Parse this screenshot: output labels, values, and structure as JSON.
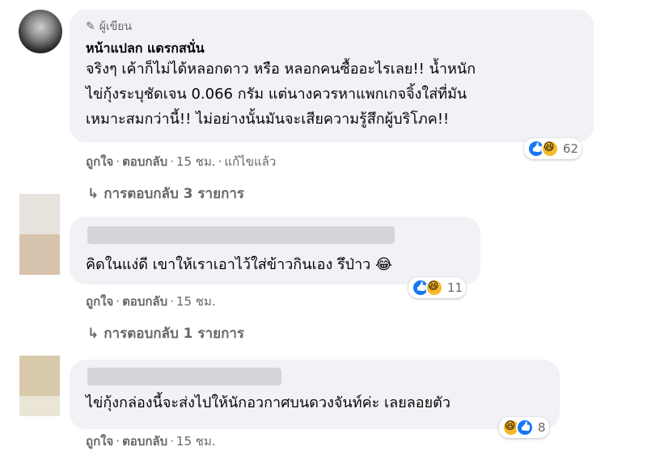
{
  "comments": [
    {
      "badge": "ผู้เขียน",
      "name": "หน้าแปลก แดรกสนั่น",
      "lines": [
        "จริงๆ เค้าก็ไม่ได้หลอกดาว หรือ หลอกคนซื้ออะไรเลย!! น้ำหนัก",
        "ไข่กุ้งระบุชัดเจน 0.066 กรัม แต่นางควรหาแพกเกจจิ้งใส่ที่มัน",
        "เหมาะสมกว่านี้!! ไม่อย่างนั้นมันจะเสียความรู้สึกผู้บริโภค!!"
      ],
      "like": "ถูกใจ",
      "reply": "ตอบกลับ",
      "time": "15 ชม.",
      "edited": "แก้ไขแล้ว",
      "reactions": "62",
      "replies_label": "การตอบกลับ 3 รายการ"
    },
    {
      "text": "คิดในแง่ดี เขาให้เราเอาไว้ใส่ข้าวกินเอง รึป่าว 😂",
      "like": "ถูกใจ",
      "reply": "ตอบกลับ",
      "time": "15 ชม.",
      "reactions": "11",
      "replies_label": "การตอบกลับ 1 รายการ"
    },
    {
      "text": "ไข่กุ้งกล่องนี้จะส่งไปให้นักอวกาศบนดวงจันท์ค่ะ เลยลอยตัว",
      "like": "ถูกใจ",
      "reply": "ตอบกลับ",
      "time": "15 ชม.",
      "reactions": "8"
    }
  ],
  "icons": [
    "pencil-icon",
    "reply-arrow-icon",
    "like-reaction-icon",
    "haha-reaction-icon"
  ],
  "colors": {
    "bubble": "#f0f2f5",
    "secondary_text": "#65676b",
    "like_blue": "#1877f2",
    "haha_yellow": "#f7b928"
  }
}
